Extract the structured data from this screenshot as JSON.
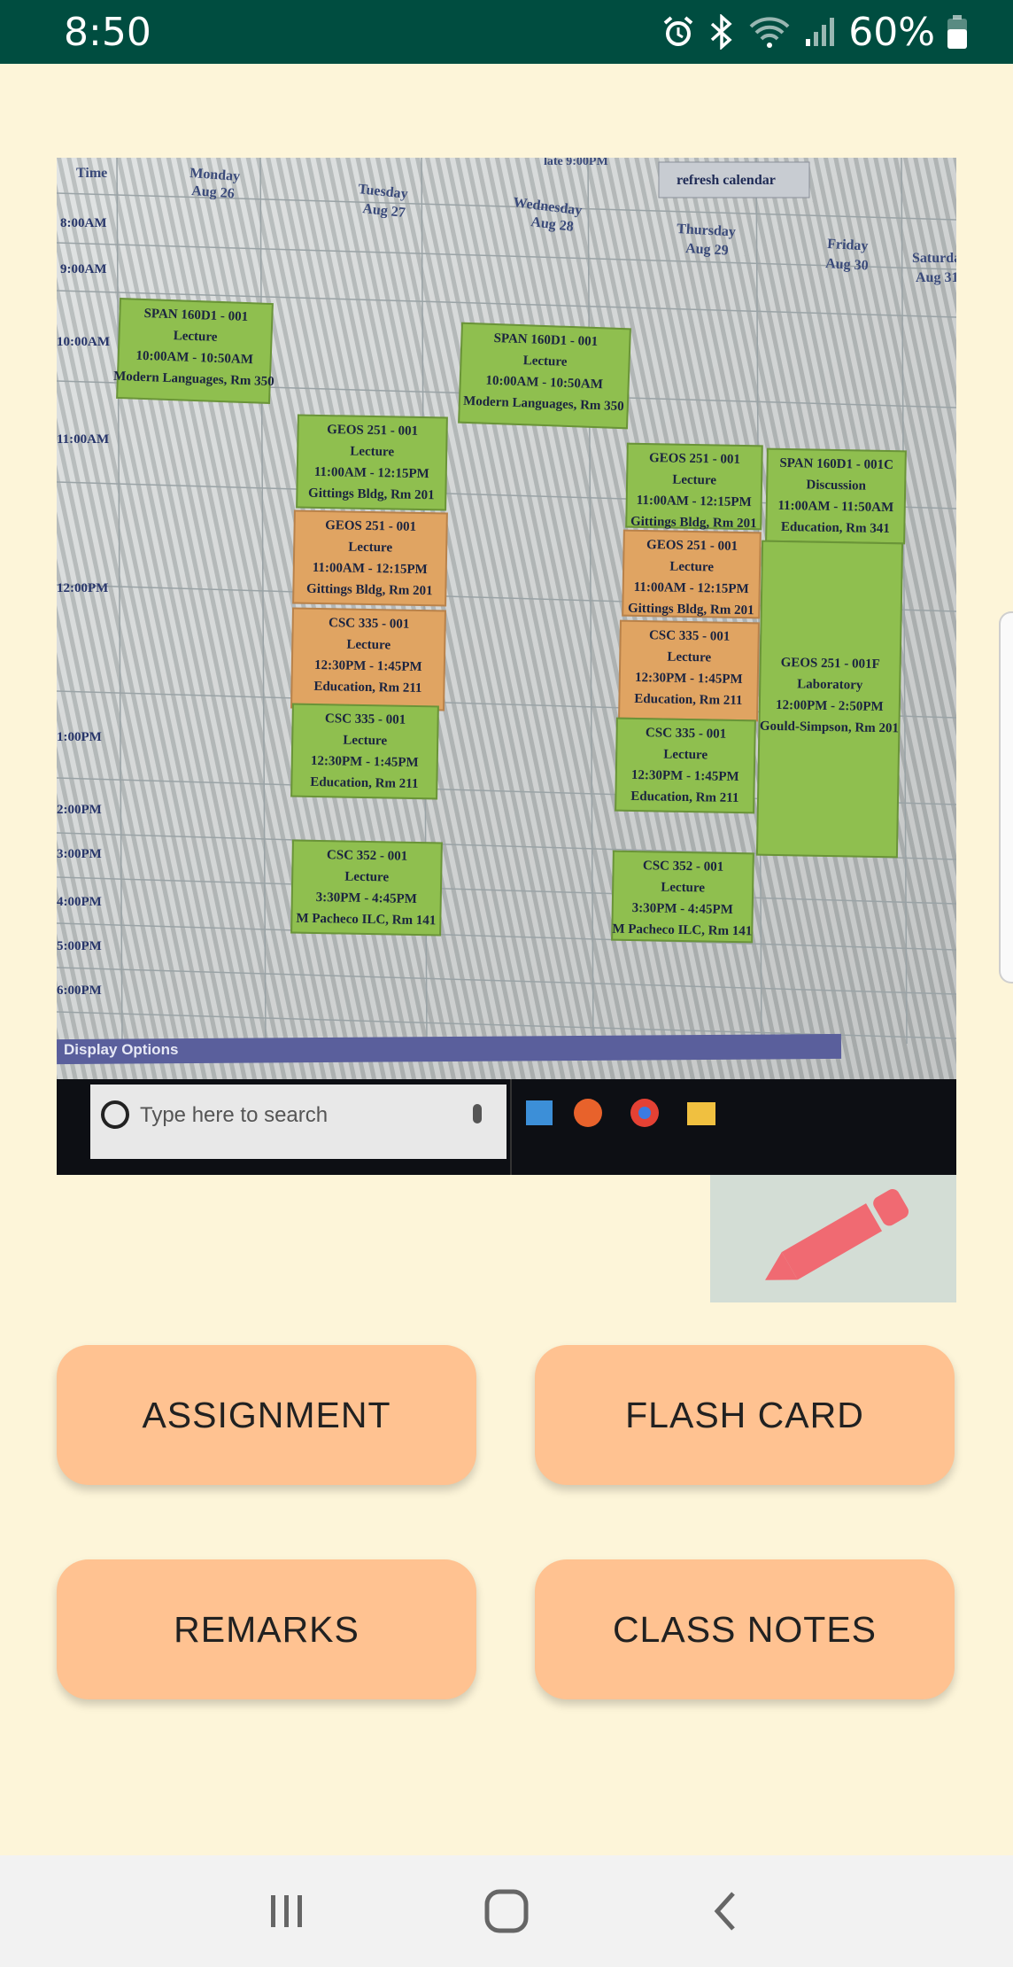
{
  "status_bar": {
    "time": "8:50",
    "battery": "60%"
  },
  "photo": {
    "header_top": "late 9:00PM",
    "refresh_label": "refresh calendar",
    "days": [
      {
        "name": "Monday",
        "date": "Aug 26"
      },
      {
        "name": "Tuesday",
        "date": "Aug 27"
      },
      {
        "name": "Wednesday",
        "date": "Aug 28"
      },
      {
        "name": "Thursday",
        "date": "Aug 29"
      },
      {
        "name": "Friday",
        "date": "Aug 30"
      },
      {
        "name": "Saturday",
        "date": "Aug 31"
      }
    ],
    "time_label": "Time",
    "times": [
      "8:00AM",
      "9:00AM",
      "10:00AM",
      "11:00AM",
      "12:00PM",
      "1:00PM",
      "2:00PM",
      "3:00PM",
      "4:00PM",
      "5:00PM",
      "6:00PM"
    ],
    "events": [
      {
        "lines": [
          "SPAN 160D1 - 001",
          "Lecture",
          "10:00AM - 10:50AM",
          "Modern Languages, Rm 350"
        ]
      },
      {
        "lines": [
          "SPAN 160D1 - 001",
          "Lecture",
          "10:00AM - 10:50AM",
          "Modern Languages, Rm 350"
        ]
      },
      {
        "lines": [
          "GEOS 251 - 001",
          "Lecture",
          "11:00AM - 12:15PM",
          "Gittings Bldg, Rm 201"
        ]
      },
      {
        "lines": [
          "GEOS 251 - 001",
          "Lecture",
          "11:00AM - 12:15PM",
          "Gittings Bldg, Rm 201"
        ]
      },
      {
        "lines": [
          "GEOS 251 - 001",
          "Lecture",
          "11:00AM - 12:15PM",
          "Gittings Bldg, Rm 201"
        ]
      },
      {
        "lines": [
          "CSC 335 - 001",
          "Lecture",
          "12:30PM - 1:45PM",
          "Education, Rm 211"
        ]
      },
      {
        "lines": [
          "CSC 335 - 001",
          "Lecture",
          "12:30PM - 1:45PM",
          "Education, Rm 211"
        ]
      },
      {
        "lines": [
          "GEOS 251 - 001",
          "Lecture",
          "11:00AM - 12:15PM",
          "Gittings Bldg, Rm 201"
        ]
      },
      {
        "lines": [
          "CSC 335 - 001",
          "Lecture",
          "12:30PM - 1:45PM",
          "Education, Rm 211"
        ]
      },
      {
        "lines": [
          "CSC 335 - 001",
          "Lecture",
          "12:30PM - 1:45PM",
          "Education, Rm 211"
        ]
      },
      {
        "lines": [
          "SPAN 160D1 - 001C",
          "Discussion",
          "11:00AM - 11:50AM",
          "Education, Rm 341"
        ]
      },
      {
        "lines": [
          "GEOS 251 - 001F",
          "Laboratory",
          "12:00PM - 2:50PM",
          "Gould-Simpson, Rm 201"
        ]
      },
      {
        "lines": [
          "CSC 352 - 001",
          "Lecture",
          "3:30PM - 4:45PM",
          "M Pacheco ILC, Rm 141"
        ]
      },
      {
        "lines": [
          "CSC 352 - 001",
          "Lecture",
          "3:30PM - 4:45PM",
          "M Pacheco ILC, Rm 141"
        ]
      }
    ],
    "display_options": "Display Options",
    "search_placeholder": "Type here to search"
  },
  "buttons": {
    "assignment": "ASSIGNMENT",
    "flash_card": "FLASH CARD",
    "remarks": "REMARKS",
    "class_notes": "CLASS NOTES"
  },
  "icons": {
    "edit": "pencil-icon",
    "nav_recents": "recents-icon",
    "nav_home": "home-icon",
    "nav_back": "back-icon"
  },
  "colors": {
    "status_bar": "#004d40",
    "background": "#fdf5d9",
    "button": "#ffc291",
    "pencil": "#f06a72",
    "edit_bg": "#d3ddd5",
    "event_green": "#8fbf4f",
    "event_orange": "#e0a462"
  }
}
